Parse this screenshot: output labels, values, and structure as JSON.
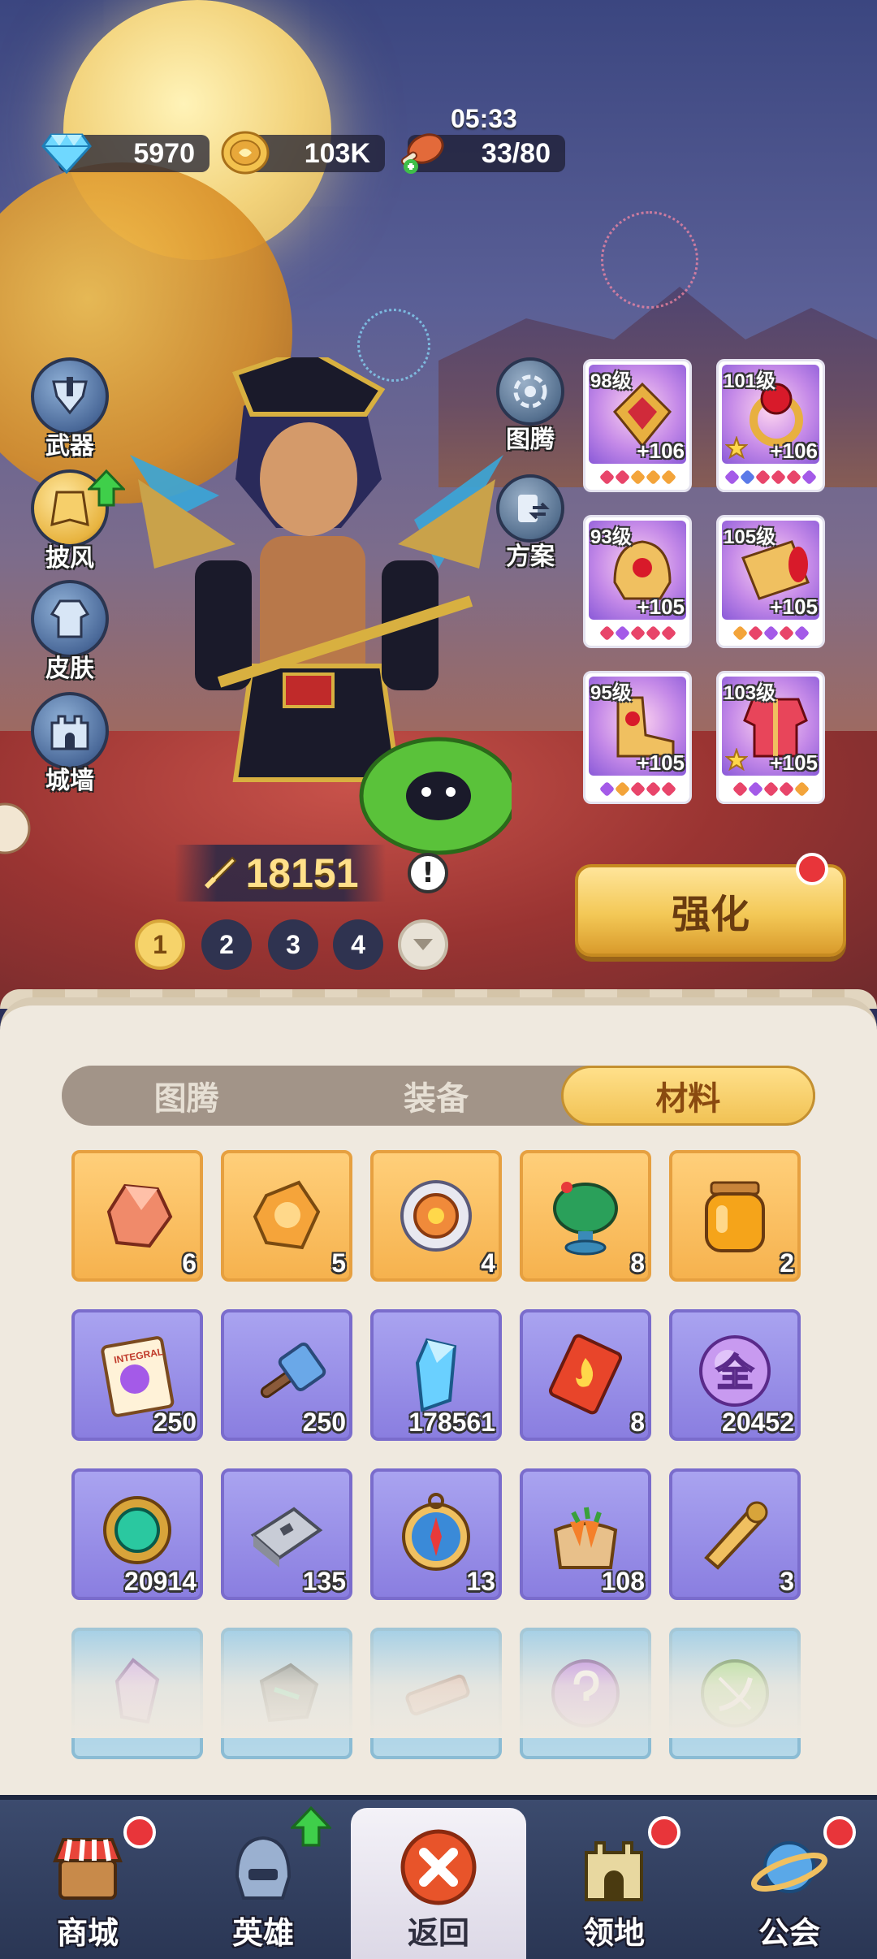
{
  "resources": {
    "gems": "5970",
    "coins": "103K",
    "stamina": "33/80",
    "stamina_timer": "05:33"
  },
  "side_menu": [
    {
      "label": "武器",
      "icon": "weapon-icon"
    },
    {
      "label": "披风",
      "icon": "cape-icon"
    },
    {
      "label": "皮肤",
      "icon": "skin-icon"
    },
    {
      "label": "城墙",
      "icon": "wall-icon"
    }
  ],
  "right_menu": [
    {
      "label": "图腾",
      "icon": "totem-icon"
    },
    {
      "label": "方案",
      "icon": "plan-icon"
    }
  ],
  "hero": {
    "power": "18151",
    "alert": "!"
  },
  "pages": [
    "1",
    "2",
    "3",
    "4"
  ],
  "equipment": [
    {
      "level": "98级",
      "plus": "+106",
      "star": false
    },
    {
      "level": "101级",
      "plus": "+106",
      "star": true
    },
    {
      "level": "93级",
      "plus": "+105",
      "star": false
    },
    {
      "level": "105级",
      "plus": "+105",
      "star": false
    },
    {
      "level": "95级",
      "plus": "+105",
      "star": false
    },
    {
      "level": "103级",
      "plus": "+105",
      "star": true
    }
  ],
  "strengthen_label": "强化",
  "tabs": [
    "图腾",
    "装备",
    "材料"
  ],
  "active_tab": "材料",
  "items": [
    {
      "count": "6",
      "style": "gold",
      "icon": "red-crystal-icon"
    },
    {
      "count": "5",
      "style": "gold",
      "icon": "orange-crystal-icon"
    },
    {
      "count": "4",
      "style": "gold",
      "icon": "compass-disc-icon"
    },
    {
      "count": "8",
      "style": "gold",
      "icon": "globe-orb-icon"
    },
    {
      "count": "2",
      "style": "gold",
      "icon": "honey-jar-icon"
    },
    {
      "count": "250",
      "style": "purple",
      "icon": "integral-scroll-icon",
      "label": "INTEGRAL"
    },
    {
      "count": "250",
      "style": "purple",
      "icon": "hammer-icon"
    },
    {
      "count": "178561",
      "style": "purple",
      "icon": "blue-crystal-icon"
    },
    {
      "count": "8",
      "style": "purple",
      "icon": "fire-ticket-icon"
    },
    {
      "count": "20452",
      "style": "purple",
      "icon": "all-orb-icon",
      "label": "全"
    },
    {
      "count": "20914",
      "style": "purple",
      "icon": "emerald-amulet-icon"
    },
    {
      "count": "135",
      "style": "purple",
      "icon": "iron-ingot-icon"
    },
    {
      "count": "13",
      "style": "purple",
      "icon": "compass-icon"
    },
    {
      "count": "108",
      "style": "purple",
      "icon": "carrot-sack-icon"
    },
    {
      "count": "3",
      "style": "purple",
      "icon": "golden-horn-icon"
    },
    {
      "count": "",
      "style": "blue",
      "icon": "purple-shard-icon"
    },
    {
      "count": "",
      "style": "blue",
      "icon": "green-stone-icon"
    },
    {
      "count": "",
      "style": "blue",
      "icon": "wood-plank-icon"
    },
    {
      "count": "",
      "style": "blue",
      "icon": "mystery-orb-icon"
    },
    {
      "count": "",
      "style": "blue",
      "icon": "bow-orb-icon"
    }
  ],
  "nav": [
    {
      "label": "商城",
      "icon": "shop-icon",
      "badge": "red-dot"
    },
    {
      "label": "英雄",
      "icon": "hero-helmet-icon",
      "badge": "up-arrow"
    },
    {
      "label": "返回",
      "icon": "close-icon",
      "badge": "",
      "active": true
    },
    {
      "label": "领地",
      "icon": "castle-icon",
      "badge": "red-dot"
    },
    {
      "label": "公会",
      "icon": "planet-icon",
      "badge": "red-dot"
    }
  ],
  "colors": {
    "accent_gold": "#f3c856",
    "badge_red": "#e8353a",
    "item_purple": "#8a7ee0",
    "item_gold": "#f6b24e"
  }
}
